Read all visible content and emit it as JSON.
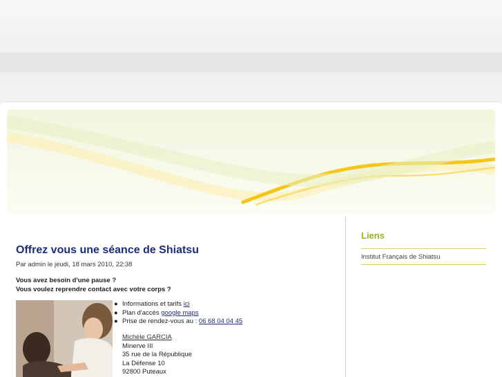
{
  "post": {
    "title": "Offrez vous une séance de Shiatsu",
    "meta": "Par admin le jeudi, 18 mars 2010, 22:38",
    "intro_lines": [
      "Vous avez besoin d'une pause ?",
      "Vous voulez reprendre contact avec votre corps ?"
    ],
    "info": {
      "item1_text": "Informations et tarifs ",
      "item1_link": "ici",
      "item2_text": "Plan d'accès ",
      "item2_link": "google maps",
      "item3_text": "Prise de rendez-vous au : ",
      "item3_link": "06 68 04 04 45"
    },
    "address": {
      "name": "Michèle GARCIA",
      "line1": "Minerve III",
      "line2": "35 rue de la République",
      "line3": "La Défense 10",
      "line4": "92800 Puteaux"
    }
  },
  "sidebar": {
    "title": "Liens",
    "links": [
      "Institut Français de Shiatsu"
    ]
  },
  "colors": {
    "title": "#1d2c7a",
    "sidebar_title": "#9bb026",
    "swoosh": "#f5c518"
  }
}
